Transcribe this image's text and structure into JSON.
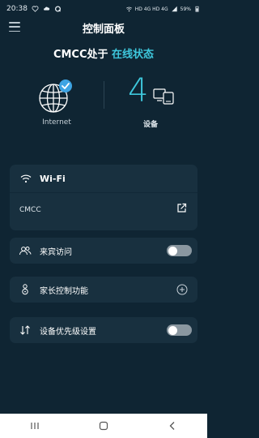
{
  "status_bar": {
    "time": "20:38",
    "right_text": "HD 4G HD 4G",
    "battery": "59%"
  },
  "header": {
    "title": "控制面板",
    "menu_icon": "hamburger-menu-icon"
  },
  "connection": {
    "prefix": "CMCC处于 ",
    "status": "在线状态",
    "accent_color": "#3ec7dc"
  },
  "overview": {
    "internet_label": "Internet",
    "device_count": "4",
    "devices_label": "设备"
  },
  "wifi": {
    "label": "Wi-Fi",
    "ssid": "CMCC"
  },
  "settings": {
    "guest_access": {
      "label": "来宾访问",
      "enabled": false
    },
    "parental_control": {
      "label": "家长控制功能"
    },
    "device_priority": {
      "label": "设备优先级设置",
      "enabled": false
    }
  },
  "nav": {
    "recent": "recent-apps-icon",
    "home": "home-icon",
    "back": "back-icon"
  }
}
